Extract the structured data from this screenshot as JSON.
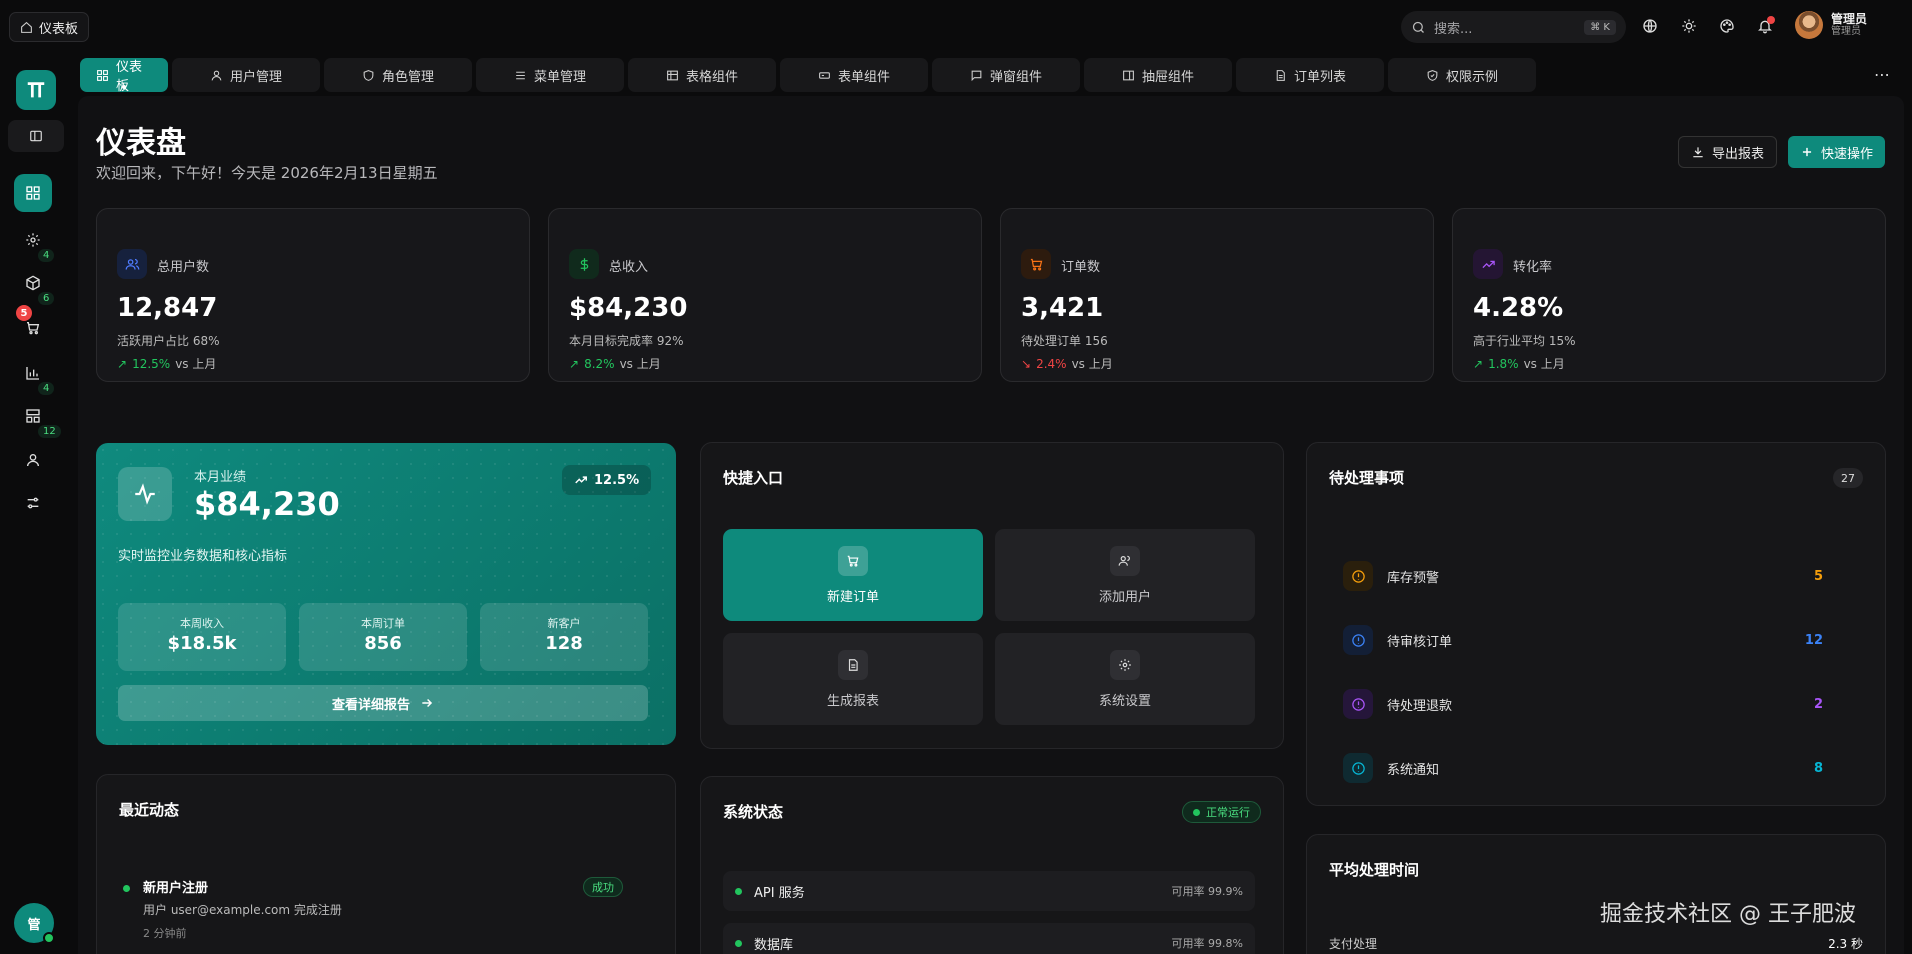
{
  "app_tab": {
    "label": "仪表板"
  },
  "search": {
    "placeholder": "搜索...",
    "shortcut": "⌘ K"
  },
  "user": {
    "name": "管理员",
    "role": "管理员"
  },
  "sidebar": {
    "badges": {
      "settings": "4",
      "box": "6",
      "cart": "5",
      "chart": "4",
      "layout": "12"
    },
    "avatar": "管"
  },
  "tabs": [
    {
      "label": "仪表板"
    },
    {
      "label": "用户管理"
    },
    {
      "label": "角色管理"
    },
    {
      "label": "菜单管理"
    },
    {
      "label": "表格组件"
    },
    {
      "label": "表单组件"
    },
    {
      "label": "弹窗组件"
    },
    {
      "label": "抽屉组件"
    },
    {
      "label": "订单列表"
    },
    {
      "label": "权限示例"
    }
  ],
  "page": {
    "title": "仪表盘",
    "subtitle": "欢迎回来，下午好！今天是 2026年2月13日星期五",
    "export_label": "导出报表",
    "quick_label": "快速操作"
  },
  "stats": [
    {
      "title": "总用户数",
      "value": "12,847",
      "desc": "活跃用户占比 68%",
      "trend": "12.5%",
      "trend_dir": "up",
      "vs": "vs 上月",
      "icon": "users-icon",
      "color": "#4f7cff"
    },
    {
      "title": "总收入",
      "value": "$84,230",
      "desc": "本月目标完成率 92%",
      "trend": "8.2%",
      "trend_dir": "up",
      "vs": "vs 上月",
      "icon": "dollar-icon",
      "color": "#22c55e"
    },
    {
      "title": "订单数",
      "value": "3,421",
      "desc": "待处理订单 156",
      "trend": "2.4%",
      "trend_dir": "down",
      "vs": "vs 上月",
      "icon": "cart-icon",
      "color": "#f97316"
    },
    {
      "title": "转化率",
      "value": "4.28%",
      "desc": "高于行业平均 15%",
      "trend": "1.8%",
      "trend_dir": "up",
      "vs": "vs 上月",
      "icon": "trending-up-icon",
      "color": "#a855f7"
    }
  ],
  "performance": {
    "label": "本月业绩",
    "value": "$84,230",
    "growth": "12.5%",
    "desc": "实时监控业务数据和核心指标",
    "minis": [
      {
        "label": "本周收入",
        "value": "$18.5k"
      },
      {
        "label": "本周订单",
        "value": "856"
      },
      {
        "label": "新客户",
        "value": "128"
      }
    ],
    "button": "查看详细报告"
  },
  "quick_entry": {
    "title": "快捷入口",
    "items": [
      {
        "label": "新建订单",
        "icon": "cart-icon"
      },
      {
        "label": "添加用户",
        "icon": "users-icon"
      },
      {
        "label": "生成报表",
        "icon": "file-icon"
      },
      {
        "label": "系统设置",
        "icon": "gear-icon"
      }
    ]
  },
  "todo": {
    "title": "待处理事项",
    "count": "27",
    "items": [
      {
        "label": "库存预警",
        "count": "5",
        "color": "#f59e0b"
      },
      {
        "label": "待审核订单",
        "count": "12",
        "color": "#3b82f6"
      },
      {
        "label": "待处理退款",
        "count": "2",
        "color": "#a855f7"
      },
      {
        "label": "系统通知",
        "count": "8",
        "color": "#06b6d4"
      }
    ]
  },
  "activity": {
    "title": "最近动态",
    "items": [
      {
        "title": "新用户注册",
        "desc": "用户 user@example.com 完成注册",
        "time": "2 分钟前",
        "badge": "成功"
      }
    ]
  },
  "system": {
    "title": "系统状态",
    "status": "正常运行",
    "rows": [
      {
        "name": "API 服务",
        "value": "可用率 99.9%"
      },
      {
        "name": "数据库",
        "value": "可用率 99.8%"
      }
    ]
  },
  "avg_time": {
    "title": "平均处理时间",
    "rows": [
      {
        "label": "支付处理",
        "value": "2.3 秒"
      }
    ]
  },
  "watermark": "掘金技术社区 @ 王子肥波"
}
